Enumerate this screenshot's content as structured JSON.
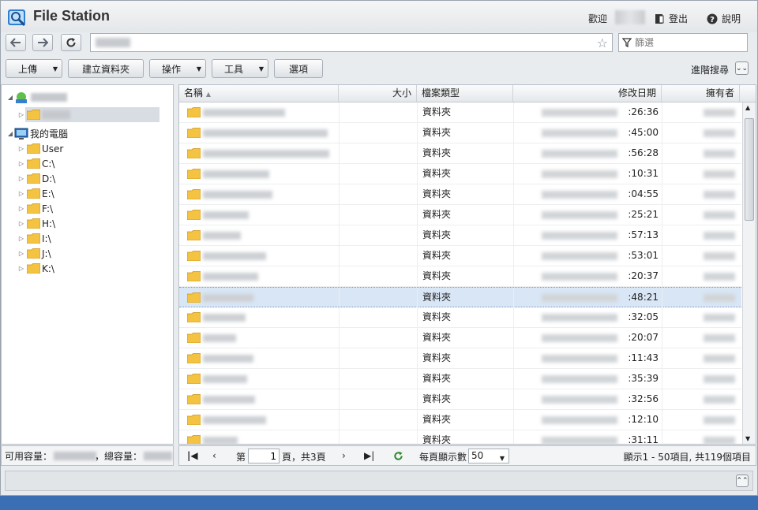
{
  "app": {
    "title": "File Station",
    "welcome": "歡迎",
    "logout": "登出",
    "help": "說明"
  },
  "nav": {
    "filter_placeholder": "篩選"
  },
  "toolbar": {
    "upload": "上傳",
    "create_folder": "建立資料夾",
    "action": "操作",
    "tools": "工具",
    "options": "選項",
    "advanced_search": "進階搜尋"
  },
  "tree": {
    "my_computer": "我的電腦",
    "items": [
      "User",
      "C:\\",
      "D:\\",
      "E:\\",
      "F:\\",
      "H:\\",
      "I:\\",
      "J:\\",
      "K:\\"
    ]
  },
  "capacity": {
    "available_label": "可用容量：",
    "total_label": "，總容量："
  },
  "grid": {
    "columns": {
      "name": "名稱",
      "size": "大小",
      "type": "檔案類型",
      "modified": "修改日期",
      "owner": "擁有者"
    },
    "rows": [
      {
        "type": "資料夾",
        "time": ":26:36"
      },
      {
        "type": "資料夾",
        "time": ":45:00"
      },
      {
        "type": "資料夾",
        "time": ":56:28"
      },
      {
        "type": "資料夾",
        "time": ":10:31"
      },
      {
        "type": "資料夾",
        "time": ":04:55"
      },
      {
        "type": "資料夾",
        "time": ":25:21"
      },
      {
        "type": "資料夾",
        "time": ":57:13"
      },
      {
        "type": "資料夾",
        "time": ":53:01"
      },
      {
        "type": "資料夾",
        "time": ":20:37"
      },
      {
        "type": "資料夾",
        "time": ":48:21",
        "selected": true
      },
      {
        "type": "資料夾",
        "time": ":32:05"
      },
      {
        "type": "資料夾",
        "time": ":20:07"
      },
      {
        "type": "資料夾",
        "time": ":11:43"
      },
      {
        "type": "資料夾",
        "time": ":35:39"
      },
      {
        "type": "資料夾",
        "time": ":32:56"
      },
      {
        "type": "資料夾",
        "time": ":12:10"
      },
      {
        "type": "資料夾",
        "time": ":31:11"
      }
    ]
  },
  "pager": {
    "page_prefix": "第",
    "page_value": "1",
    "page_suffix": "頁，共3頁",
    "per_page_label": "每頁顯示數",
    "per_page_value": "50",
    "summary": "顯示1 - 50項目, 共119個項目"
  },
  "colors": {
    "accent": "#2f64a8",
    "folder": "#f5c342",
    "selected_row": "#d9e6f5",
    "refresh": "#2e8b2e"
  }
}
